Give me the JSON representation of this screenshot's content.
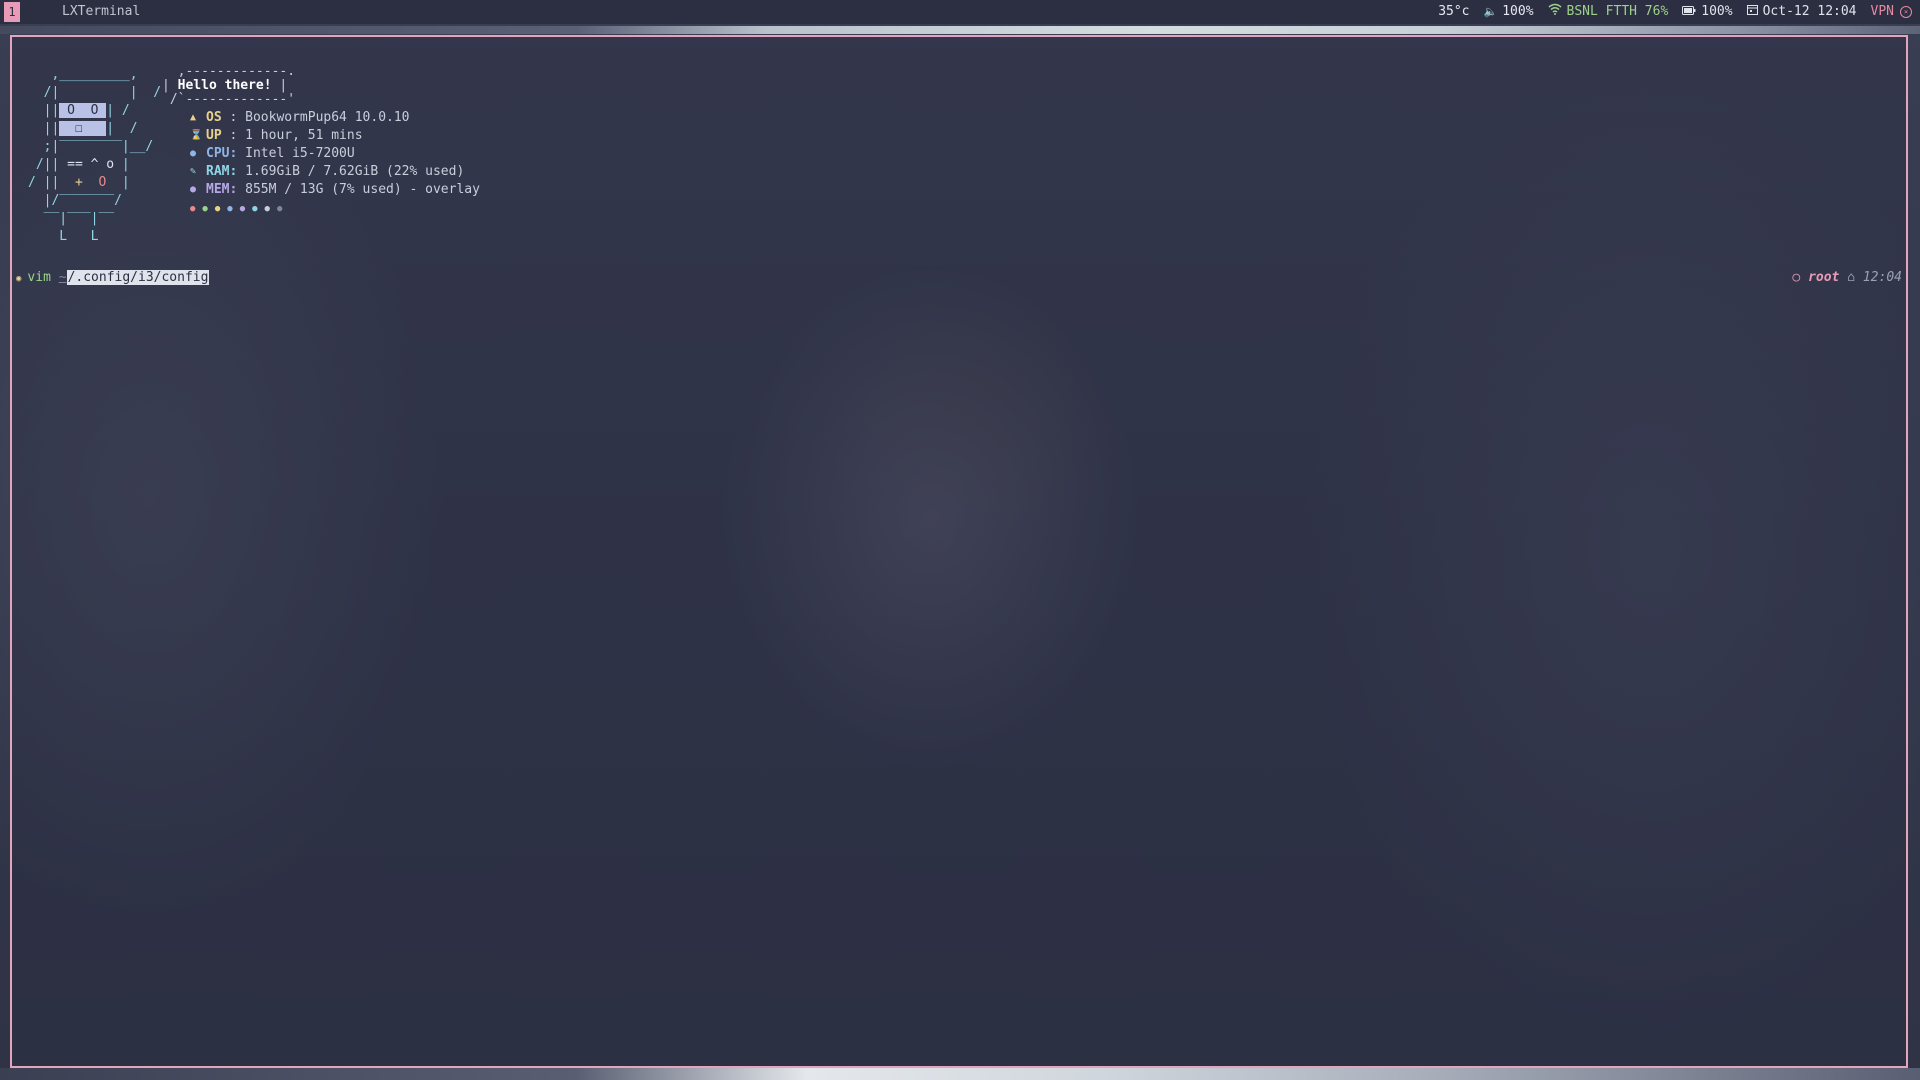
{
  "topbar": {
    "workspace": "1",
    "window_title": "LXTerminal",
    "temperature": "35°c",
    "volume": "100%",
    "network": "BSNL FTTH 76%",
    "battery": "100%",
    "datetime": "Oct-12 12:04",
    "vpn": "VPN",
    "icons": [
      "volume-icon",
      "wifi-icon",
      "battery-icon",
      "calendar-icon",
      "vpn-icon"
    ]
  },
  "terminal": {
    "bubble_text": "Hello there!",
    "info": {
      "os_key": "OS",
      "os_val": " : BookwormPup64 10.0.10",
      "up_key": "UP",
      "up_val": " : 1 hour, 51 mins",
      "cpu_key": "CPU:",
      "cpu_val": " Intel i5-7200U",
      "ram_key": "RAM:",
      "ram_val": " 1.69GiB / 7.62GiB (22% used)",
      "mem_key": "MEM:",
      "mem_val": " 855M / 13G (7% used) - overlay"
    },
    "prompt": {
      "command": "vim",
      "tilde": "~",
      "path": "/.config/i3/config",
      "user": "root",
      "time": "12:04"
    }
  },
  "colors": {
    "accent": "#e79bb6",
    "bar_bg": "#2b2f41",
    "wifi": "#9ed18a",
    "vpn": "#e68aa4"
  }
}
